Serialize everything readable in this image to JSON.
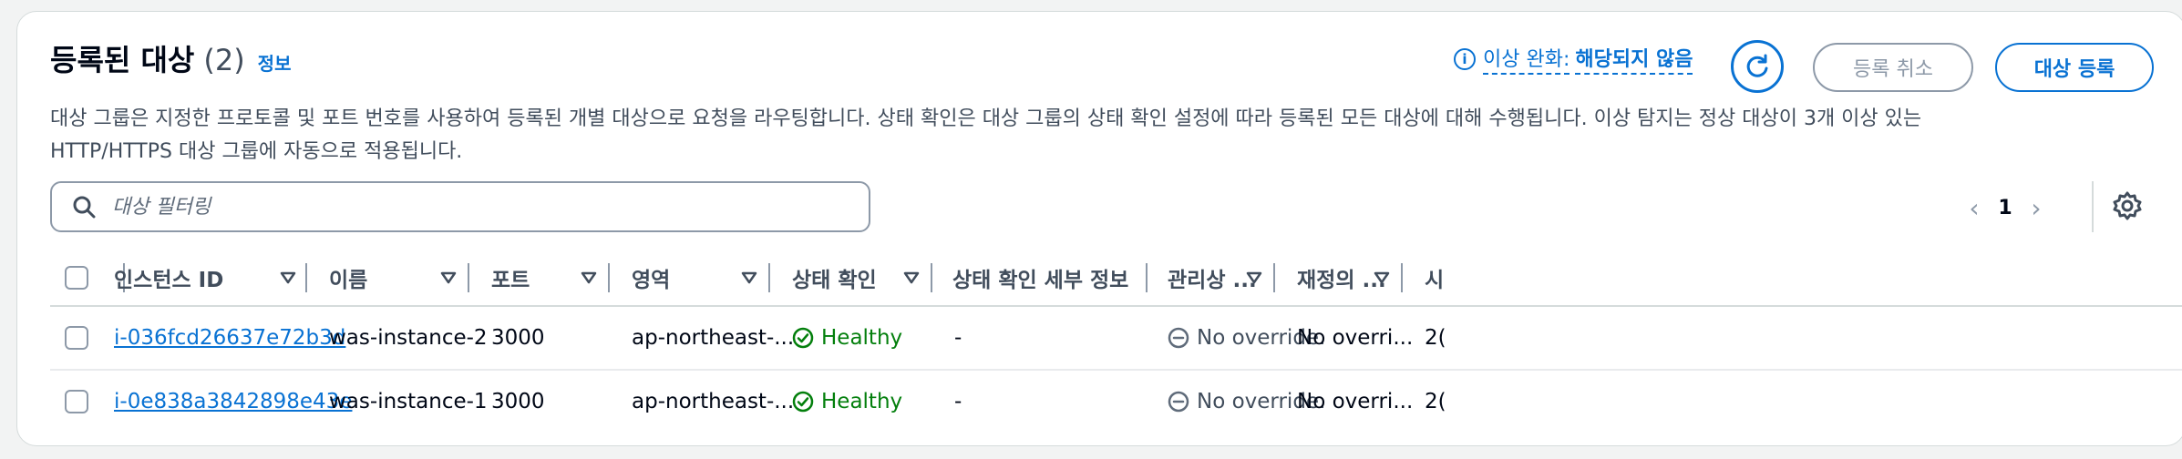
{
  "header": {
    "title": "등록된 대상",
    "count": "(2)",
    "info_link": "정보",
    "anomaly_label": "이상 완화:",
    "anomaly_value": "해당되지 않음",
    "cancel_label": "등록 취소",
    "register_label": "대상 등록"
  },
  "description": {
    "line1": "대상 그룹은 지정한 프로토콜 및 포트 번호를 사용하여 등록된 개별 대상으로 요청을 라우팅합니다. 상태 확인은 대상 그룹의 상태 확인 설정에 따라 등록된 모든 대상에 대해 수행됩니다. 이상 탐지는 정상 대상이 3개 이상 있는",
    "line2": "HTTP/HTTPS 대상 그룹에 자동으로 적용됩니다."
  },
  "filter": {
    "placeholder": "대상 필터링"
  },
  "pagination": {
    "page": "1"
  },
  "table": {
    "columns": {
      "instance_id": "인스턴스 ID",
      "name": "이름",
      "port": "포트",
      "zone": "영역",
      "health": "상태 확인",
      "health_details": "상태 확인 세부 정보",
      "admin": "관리상 ...",
      "override": "재정의 ...",
      "next": "시"
    },
    "rows": [
      {
        "instance_id": "i-036fcd26637e72b3d",
        "name": "was-instance-2",
        "port": "3000",
        "zone": "ap-northeast-...",
        "health": "Healthy",
        "health_details": "-",
        "admin": "No override.",
        "override": "No overri...",
        "next": "2("
      },
      {
        "instance_id": "i-0e838a3842898e43e",
        "name": "was-instance-1",
        "port": "3000",
        "zone": "ap-northeast-...",
        "health": "Healthy",
        "health_details": "-",
        "admin": "No override.",
        "override": "No overri...",
        "next": "2("
      }
    ]
  },
  "colors": {
    "accent": "#0972d3",
    "healthy": "#037f0c",
    "muted": "#8d99a8"
  }
}
